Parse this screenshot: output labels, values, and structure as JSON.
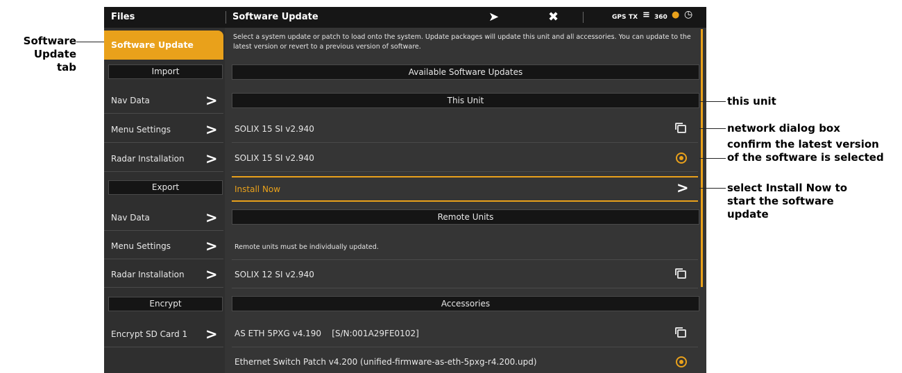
{
  "titlebar": {
    "left_title": "Files",
    "right_title": "Software Update",
    "home_icon": "home-icon",
    "close_icon": "close-icon",
    "status": {
      "gps": "GPS",
      "tx": "TX",
      "depth_icon": "sonar-icon",
      "number": "360"
    }
  },
  "sidebar": {
    "active_tab": "Software Update",
    "sections": [
      {
        "title": "Import",
        "items": [
          "Nav Data",
          "Menu Settings",
          "Radar Installation"
        ]
      },
      {
        "title": "Export",
        "items": [
          "Nav Data",
          "Menu Settings",
          "Radar Installation"
        ]
      },
      {
        "title": "Encrypt",
        "items": [
          "Encrypt SD Card 1"
        ]
      }
    ],
    "chevron": ">"
  },
  "main": {
    "intro": "Select a system update or patch to load onto the system. Update packages will update this unit and all accessories. You can update to the latest version or revert to a previous version of software.",
    "available_header": "Available Software Updates",
    "this_unit_header": "This Unit",
    "this_unit_items": [
      "SOLIX 15 SI v2.940",
      "SOLIX 15 SI v2.940"
    ],
    "install_now": "Install Now",
    "remote_header": "Remote Units",
    "remote_note": "Remote units must be individually updated.",
    "remote_items": [
      "SOLIX 12 SI v2.940"
    ],
    "accessories_header": "Accessories",
    "accessories_items": [
      "AS ETH 5PXG v4.190    [S/N:001A29FE0102]",
      "Ethernet Switch Patch v4.200 (unified-firmware-as-eth-5pxg-r4.200.upd)"
    ]
  },
  "callouts": {
    "software_update_tab": [
      "Software",
      "Update tab"
    ],
    "this_unit": "this unit",
    "network_dialog": "network dialog box",
    "confirm_latest": [
      "confirm the latest version",
      "of the software is selected"
    ],
    "select_install": [
      "select Install Now to",
      "start the software",
      "update"
    ]
  },
  "colors": {
    "accent": "#e9a11b",
    "background": "#353535",
    "titlebar": "#161616"
  }
}
